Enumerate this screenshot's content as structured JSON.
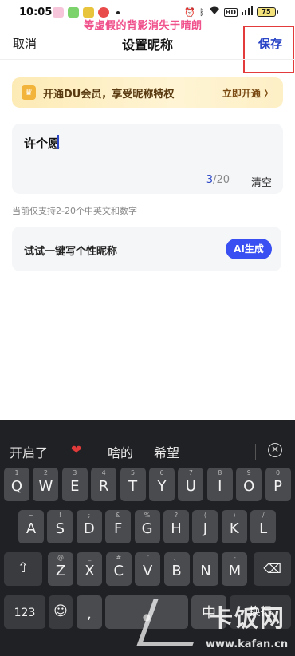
{
  "status_bar": {
    "time": "10:05",
    "battery": "75"
  },
  "caption": "等虚假的背影消失于晴朗",
  "nav": {
    "cancel": "取消",
    "title": "设置昵称",
    "save": "保存"
  },
  "vip": {
    "text": "开通DU会员，享受昵称特权",
    "link": "立即开通 〉"
  },
  "nickname": {
    "value": "许个愿",
    "count_current": "3",
    "count_max": "/20",
    "clear": "清空",
    "hint": "当前仅支持2-20个中英文和数字"
  },
  "ai": {
    "text": "试试一键写个性昵称",
    "button": "AI生成"
  },
  "keyboard": {
    "suggestions": [
      "开启了",
      "❤",
      "啥的",
      "希望"
    ],
    "row1": [
      {
        "k": "Q",
        "n": "1"
      },
      {
        "k": "W",
        "n": "2"
      },
      {
        "k": "E",
        "n": "3"
      },
      {
        "k": "R",
        "n": "4"
      },
      {
        "k": "T",
        "n": "5"
      },
      {
        "k": "Y",
        "n": "6"
      },
      {
        "k": "U",
        "n": "7"
      },
      {
        "k": "I",
        "n": "8"
      },
      {
        "k": "O",
        "n": "9"
      },
      {
        "k": "P",
        "n": "0"
      }
    ],
    "row2": [
      {
        "k": "A",
        "n": "~"
      },
      {
        "k": "S",
        "n": "!"
      },
      {
        "k": "D",
        "n": ";"
      },
      {
        "k": "F",
        "n": "&"
      },
      {
        "k": "G",
        "n": "%"
      },
      {
        "k": "H",
        "n": "?"
      },
      {
        "k": "J",
        "n": "("
      },
      {
        "k": "K",
        "n": ")"
      },
      {
        "k": "L",
        "n": "/"
      }
    ],
    "row3": [
      {
        "k": "Z",
        "n": "@"
      },
      {
        "k": "X",
        "n": "_"
      },
      {
        "k": "C",
        "n": "#"
      },
      {
        "k": "V",
        "n": "\""
      },
      {
        "k": "B",
        "n": "、"
      },
      {
        "k": "N",
        "n": "…"
      },
      {
        "k": "M",
        "n": "-"
      }
    ],
    "num_key": "123",
    "comma_key": ",",
    "lang_key": "中",
    "enter_key": "换行"
  },
  "watermark": {
    "brand": "卡饭网",
    "url": "www.kafan.cn"
  }
}
